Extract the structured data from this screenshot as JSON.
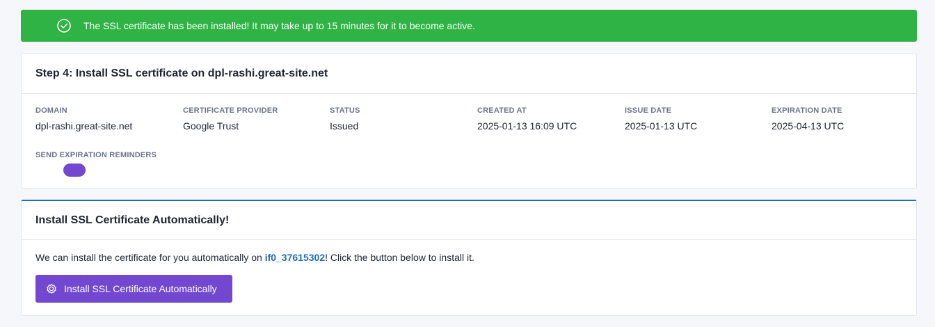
{
  "alert": {
    "icon": "check-circle-icon",
    "message": "The SSL certificate has been installed! It may take up to 15 minutes for it to become active.",
    "color": "#2fb344"
  },
  "details_card": {
    "title": "Step 4: Install SSL certificate on dpl-rashi.great-site.net",
    "fields": [
      {
        "label": "DOMAIN",
        "value": "dpl-rashi.great-site.net"
      },
      {
        "label": "CERTIFICATE PROVIDER",
        "value": "Google Trust"
      },
      {
        "label": "STATUS",
        "value": "Issued"
      },
      {
        "label": "CREATED AT",
        "value": "2025-01-13 16:09 UTC"
      },
      {
        "label": "ISSUE DATE",
        "value": "2025-01-13 UTC"
      },
      {
        "label": "EXPIRATION DATE",
        "value": "2025-04-13 UTC"
      }
    ],
    "reminders": {
      "label": "SEND EXPIRATION REMINDERS",
      "toggle_color": "#7248d0"
    }
  },
  "auto_card": {
    "title": "Install SSL Certificate Automatically!",
    "text_before": "We can install the certificate for you automatically on ",
    "account_link": "if0_37615302",
    "text_after": "! Click the button below to install it.",
    "button_label": "Install SSL Certificate Automatically",
    "button_icon": "gear-icon",
    "accent_color": "#206bc4",
    "button_color": "#7248d0"
  }
}
